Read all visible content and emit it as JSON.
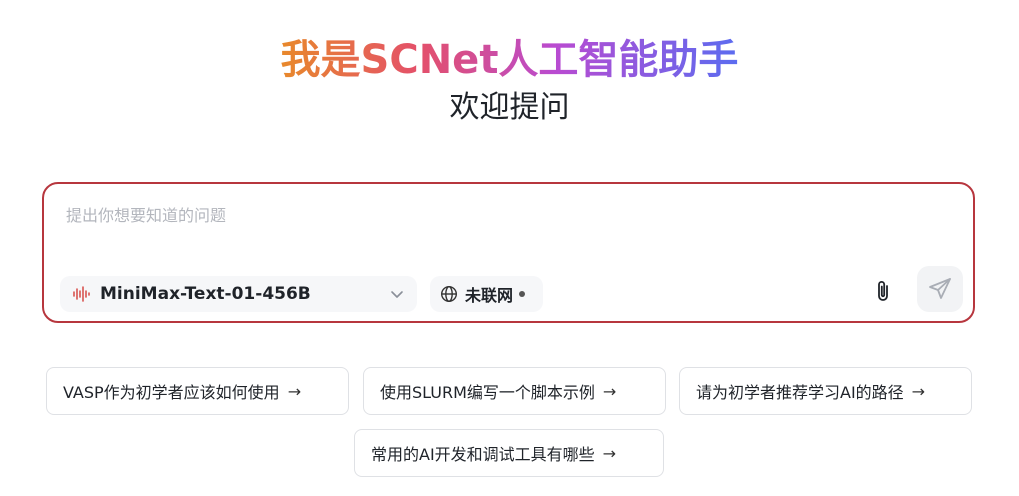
{
  "header": {
    "title": "我是SCNet人工智能助手",
    "subtitle": "欢迎提问"
  },
  "composer": {
    "placeholder": "提出你想要知道的问题",
    "model_label": "MiniMax-Text-01-456B",
    "network_label": "未联网",
    "icons": {
      "model": "waveform-icon",
      "model_dropdown": "chevron-down-icon",
      "network": "globe-icon",
      "attach": "paperclip-icon",
      "send": "send-icon"
    }
  },
  "suggestions": [
    {
      "label": "VASP作为初学者应该如何使用",
      "arrow": "→"
    },
    {
      "label": "使用SLURM编写一个脚本示例",
      "arrow": "→"
    },
    {
      "label": "请为初学者推荐学习AI的路径",
      "arrow": "→"
    },
    {
      "label": "常用的AI开发和调试工具有哪些",
      "arrow": "→"
    }
  ],
  "colors": {
    "title_gradient": [
      "#e8892b",
      "#e4506a",
      "#b94bd1",
      "#5b6cf0"
    ],
    "composer_border": "#b7363e",
    "wave_icon": "#d9534f"
  }
}
